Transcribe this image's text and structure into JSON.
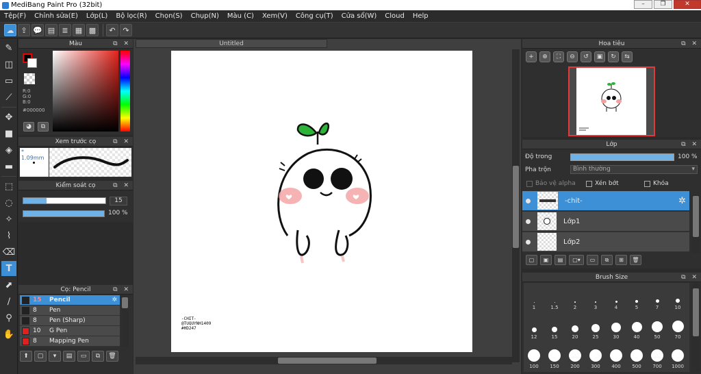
{
  "window": {
    "title": "MediBang Paint Pro (32bit)"
  },
  "menu": [
    "Tệp(F)",
    "Chỉnh sửa(E)",
    "Lớp(L)",
    "Bộ lọc(R)",
    "Chọn(S)",
    "Chụp(N)",
    "Màu (C)",
    "Xem(V)",
    "Công cụ(T)",
    "Cửa sổ(W)",
    "Cloud",
    "Help"
  ],
  "toolbar": {
    "icons": [
      "cloud-icon",
      "upload-icon",
      "comment-icon",
      "document-icon",
      "page-icon",
      "grid-icon",
      "panels-icon",
      "undo-icon",
      "redo-icon"
    ]
  },
  "tools": {
    "icons": [
      "brush-icon",
      "eraser-icon",
      "rectangle-icon",
      "pen-line-icon",
      "move-icon",
      "fill-rect-icon",
      "bucket-icon",
      "gradient-icon",
      "select-rect-icon",
      "lasso-icon",
      "magic-wand-icon",
      "select-pen-icon",
      "select-eraser-icon",
      "text-icon",
      "operation-icon",
      "blur-icon",
      "eyedropper-icon",
      "hand-icon"
    ]
  },
  "color_panel": {
    "title": "Màu",
    "r": "R:0",
    "g": "G:0",
    "b": "B:0",
    "hex": "#000000",
    "fg_color": "#000000",
    "bg_color": "#ffffff"
  },
  "brush_preview": {
    "title": "Xem trước cọ",
    "size_label": "1.09mm"
  },
  "brush_control": {
    "title": "Kiểm soát cọ",
    "size_value": "15",
    "opacity_value": "100 %",
    "size_level": 0.28,
    "opacity_level": 1.0
  },
  "brush_list": {
    "title": "Cọ: Pencil",
    "items": [
      {
        "num": "15",
        "name": "Pencil",
        "color": "#222222",
        "selected": true
      },
      {
        "num": "8",
        "name": "Pen",
        "color": "#222222"
      },
      {
        "num": "8",
        "name": "Pen (Sharp)",
        "color": "#222222"
      },
      {
        "num": "10",
        "name": "G Pen",
        "color": "#e02020"
      },
      {
        "num": "8",
        "name": "Mapping Pen",
        "color": "#e02020"
      }
    ]
  },
  "canvas": {
    "doc_title": "Untitled",
    "credit_line1": "-CHIT-",
    "credit_line2": "@TUQUYNH1409",
    "credit_line3": "#HD247"
  },
  "navigator": {
    "title": "Hoa tiêu"
  },
  "layer_panel": {
    "title": "Lớp",
    "opacity_label": "Độ trong",
    "opacity_value": "100 %",
    "opacity_level": 1.0,
    "blend_label": "Pha trộn",
    "blend_value": "Bình thường",
    "protect_alpha": "Bảo vệ alpha",
    "clipping": "Xén bớt",
    "lock": "Khóa",
    "layers": [
      {
        "name": "-chit-",
        "selected": true
      },
      {
        "name": "Lớp1"
      },
      {
        "name": "Lớp2"
      }
    ]
  },
  "brush_size": {
    "title": "Brush Size",
    "row1": [
      "1",
      "1.5",
      "2",
      "3",
      "4",
      "5",
      "7",
      "10"
    ],
    "row2": [
      "12",
      "15",
      "20",
      "25",
      "30",
      "40",
      "50",
      "70"
    ],
    "row3": [
      "100",
      "150",
      "200",
      "300",
      "400",
      "500",
      "700",
      "1000"
    ]
  }
}
